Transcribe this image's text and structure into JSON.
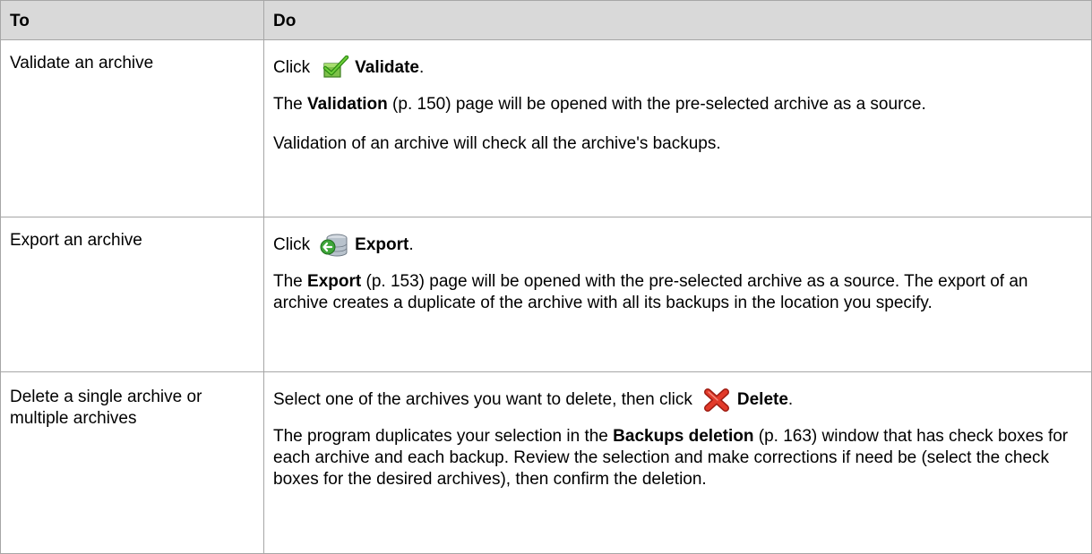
{
  "header": {
    "col_to": "To",
    "col_do": "Do"
  },
  "rows": [
    {
      "to": "Validate an archive",
      "action": {
        "prefix": "Click",
        "icon": "validate-checkmark-icon",
        "label": "Validate",
        "suffix": "."
      },
      "desc1": {
        "bold": "Validation",
        "rest": " (p. 150) page will be opened with the pre-selected archive as a source.",
        "lead": "The "
      },
      "desc2": "Validation of an archive will check all the archive's backups."
    },
    {
      "to": "Export an archive",
      "action": {
        "prefix": "Click",
        "icon": "export-database-icon",
        "label": "Export",
        "suffix": "."
      },
      "desc1": {
        "lead": "The ",
        "bold": "Export",
        "rest": " (p. 153) page will be opened with the pre-selected archive as a source. The export of an archive creates a duplicate of the archive with all its backups in the location you specify."
      }
    },
    {
      "to": "Delete a single archive or multiple archives",
      "action": {
        "prefix": "Select one of the archives you want to delete, then click",
        "icon": "delete-x-icon",
        "label": "Delete",
        "suffix": "."
      },
      "desc1": {
        "lead": "The program duplicates your selection in the ",
        "bold": "Backups deletion",
        "rest": " (p. 163) window that has check boxes for each archive and each backup. Review the selection and make corrections if need be (select the check boxes for the desired archives), then confirm the deletion."
      }
    }
  ]
}
